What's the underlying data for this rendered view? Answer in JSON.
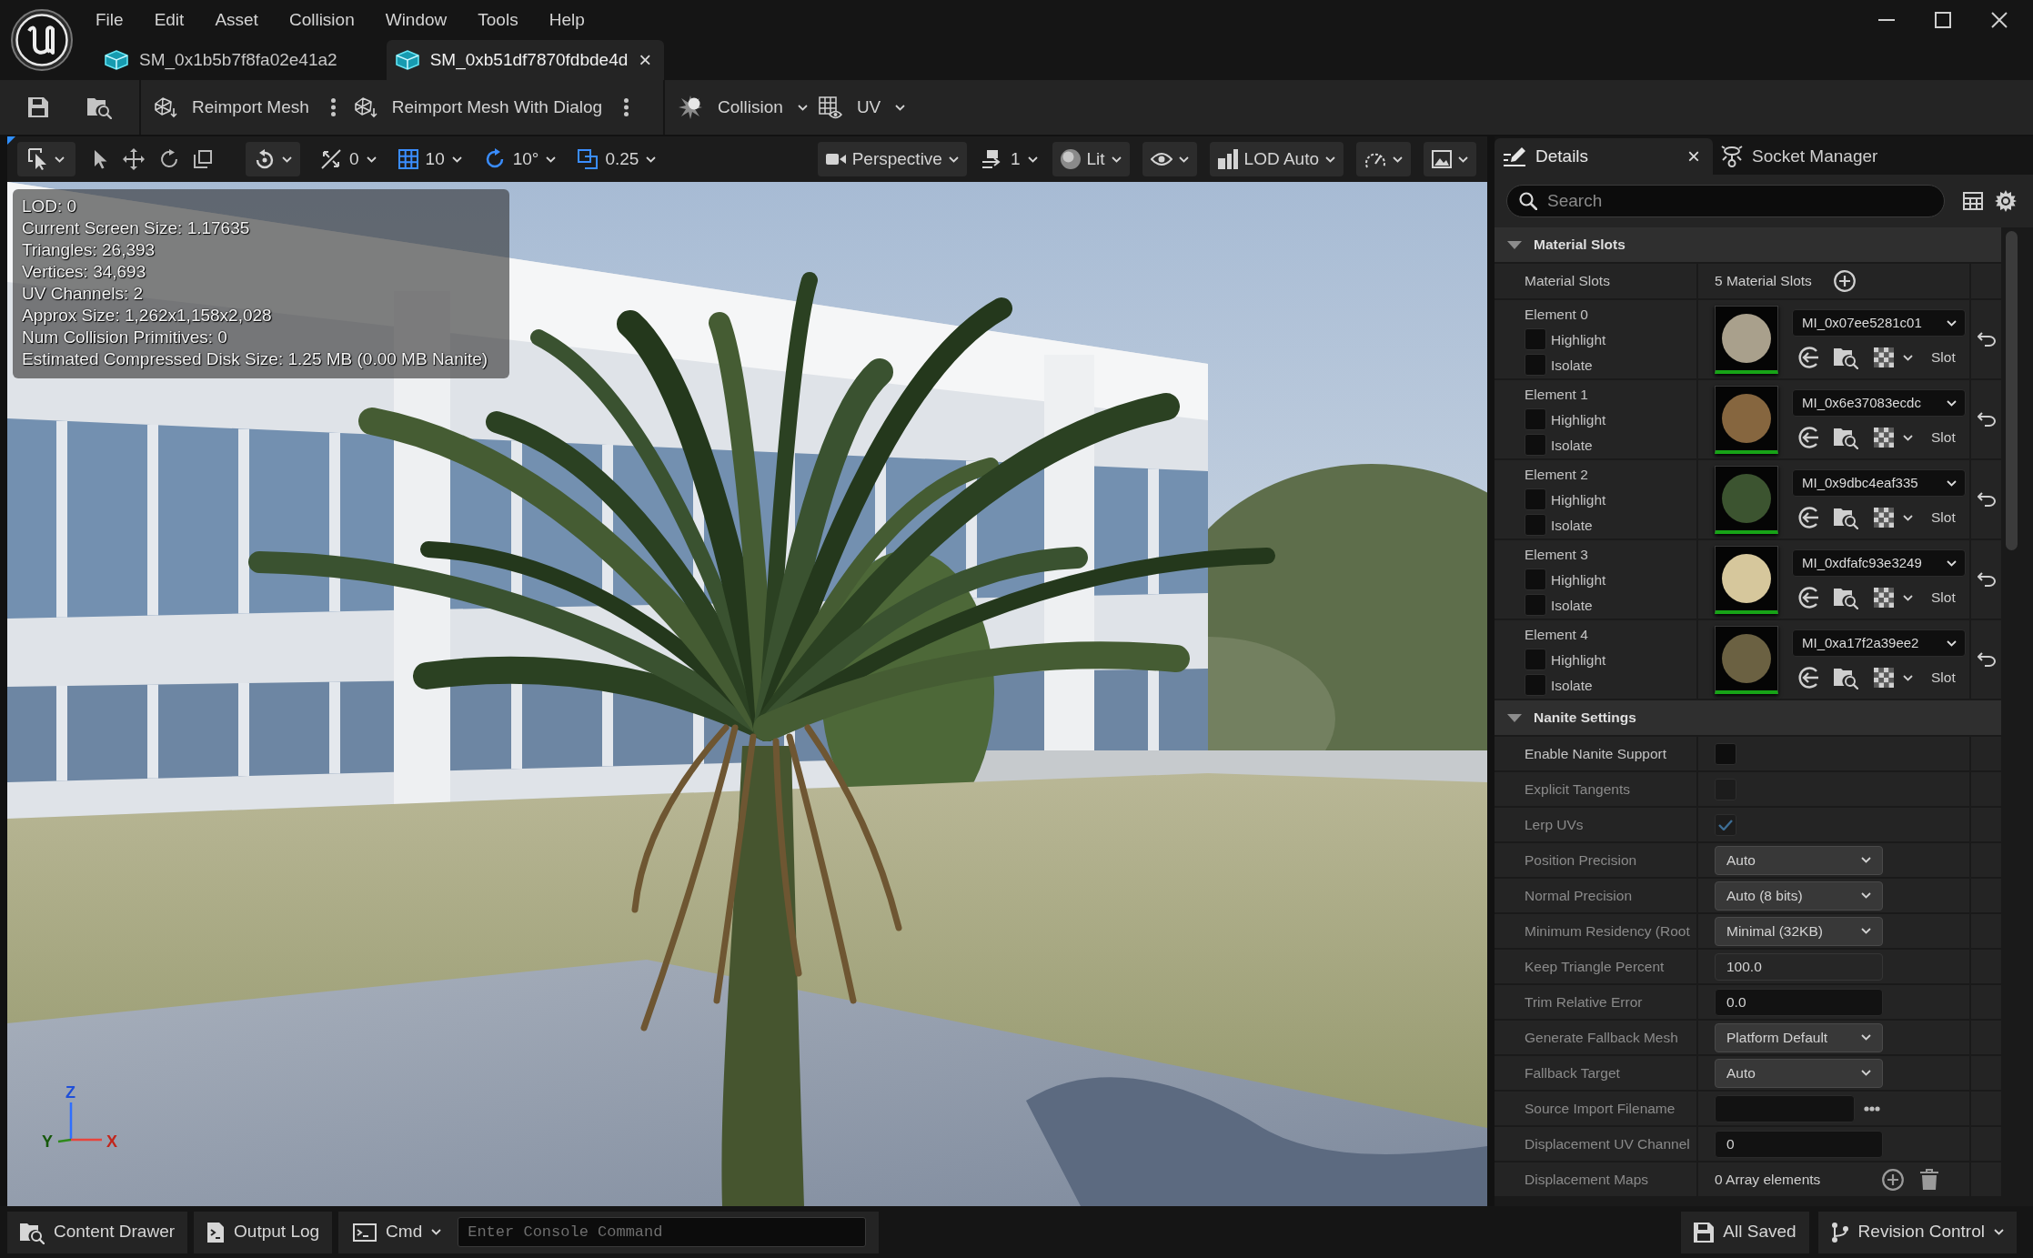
{
  "title_bar": {
    "menu": [
      "File",
      "Edit",
      "Asset",
      "Collision",
      "Window",
      "Tools",
      "Help"
    ],
    "tabs": [
      {
        "label": "SM_0x1b5b7f8fa02e41a2",
        "selected": false
      },
      {
        "label": "SM_0xb51df7870fdbde4d",
        "selected": true,
        "close": "×"
      }
    ]
  },
  "toolbar": {
    "buttons": [
      {
        "kind": "split",
        "label": "Reimport Mesh"
      },
      {
        "kind": "split",
        "label": "Reimport Mesh With Dialog"
      },
      {
        "kind": "dropdown",
        "label": "Collision"
      },
      {
        "kind": "dropdown",
        "label": "UV"
      }
    ]
  },
  "viewport": {
    "toolbar": {
      "snaps": [
        {
          "value": "0",
          "on": false
        },
        {
          "value": "10",
          "on": true
        },
        {
          "value": "10°",
          "on": true
        },
        {
          "value": "0.25",
          "on": true
        }
      ],
      "view": "Perspective",
      "camera_speed": "1",
      "view_mode": "Lit",
      "lod": "LOD Auto"
    },
    "stats": [
      "LOD: 0",
      "Current Screen Size: 1.17635",
      "Triangles: 26,393",
      "Vertices: 34,693",
      "UV Channels: 2",
      "Approx Size: 1,262x1,158x2,028",
      "Num Collision Primitives: 0",
      "Estimated Compressed Disk Size: 1.25 MB (0.00 MB Nanite)"
    ],
    "axes": [
      "Z",
      "Y",
      "X"
    ]
  },
  "details": {
    "tabs": [
      {
        "label": "Details",
        "selected": true,
        "close": "×"
      },
      {
        "label": "Socket Manager",
        "selected": false
      }
    ],
    "search": {
      "placeholder": "Search"
    },
    "material_slots": {
      "title": "Material Slots",
      "expanded": true,
      "label": "Material Slots",
      "count": "5 Material Slots",
      "slots": [
        {
          "name": "Element 0",
          "highlight": {
            "label": "Highlight",
            "checked": false
          },
          "isolate": {
            "label": "Isolate",
            "checked": false
          },
          "material": "MI_0x07ee5281c01",
          "color": "#a9a08c",
          "slot": "Slot"
        },
        {
          "name": "Element 1",
          "highlight": {
            "label": "Highlight",
            "checked": false
          },
          "isolate": {
            "label": "Isolate",
            "checked": false
          },
          "material": "MI_0x6e37083ecdc",
          "color": "#86663f",
          "slot": "Slot"
        },
        {
          "name": "Element 2",
          "highlight": {
            "label": "Highlight",
            "checked": false
          },
          "isolate": {
            "label": "Isolate",
            "checked": false
          },
          "material": "MI_0x9dbc4eaf335",
          "color": "#3c5430",
          "slot": "Slot"
        },
        {
          "name": "Element 3",
          "highlight": {
            "label": "Highlight",
            "checked": false
          },
          "isolate": {
            "label": "Isolate",
            "checked": false
          },
          "material": "MI_0xdfafc93e3249",
          "color": "#d6c79c",
          "slot": "Slot"
        },
        {
          "name": "Element 4",
          "highlight": {
            "label": "Highlight",
            "checked": false
          },
          "isolate": {
            "label": "Isolate",
            "checked": false
          },
          "material": "MI_0xa17f2a39ee2",
          "color": "#6b6142",
          "slot": "Slot"
        }
      ]
    },
    "nanite": {
      "title": "Nanite Settings",
      "expanded": true,
      "rows": [
        {
          "kind": "checkbox",
          "label": "Enable Nanite Support",
          "checked": false,
          "disabled": false
        },
        {
          "kind": "checkbox",
          "label": "Explicit Tangents",
          "checked": false,
          "disabled": true
        },
        {
          "kind": "checkbox",
          "label": "Lerp UVs",
          "checked": true,
          "disabled": true
        },
        {
          "kind": "dropdown",
          "label": "Position Precision",
          "value": "Auto",
          "disabled": true
        },
        {
          "kind": "dropdown",
          "label": "Normal Precision",
          "value": "Auto (8 bits)",
          "disabled": true
        },
        {
          "kind": "dropdown",
          "label": "Minimum Residency (Root",
          "value": "Minimal (32KB)",
          "disabled": true
        },
        {
          "kind": "spinbox",
          "label": "Keep Triangle Percent",
          "value": "100.0",
          "disabled": true
        },
        {
          "kind": "field",
          "label": "Trim Relative Error",
          "value": "0.0",
          "disabled": true
        },
        {
          "kind": "dropdown",
          "label": "Generate Fallback Mesh",
          "value": "Platform Default",
          "disabled": true
        },
        {
          "kind": "dropdown",
          "label": "Fallback Target",
          "value": "Auto",
          "disabled": true
        },
        {
          "kind": "file",
          "label": "Source Import Filename",
          "disabled": true
        },
        {
          "kind": "field",
          "label": "Displacement UV Channel",
          "value": "0",
          "disabled": true
        },
        {
          "kind": "array",
          "label": "Displacement Maps",
          "value": "0 Array elements",
          "disabled": true
        }
      ]
    }
  },
  "status_bar": {
    "content_drawer": "Content Drawer",
    "output_log": "Output Log",
    "cmd": "Cmd",
    "console": {
      "placeholder": "Enter Console Command"
    },
    "saved": "All Saved",
    "revision_control": "Revision Control"
  }
}
